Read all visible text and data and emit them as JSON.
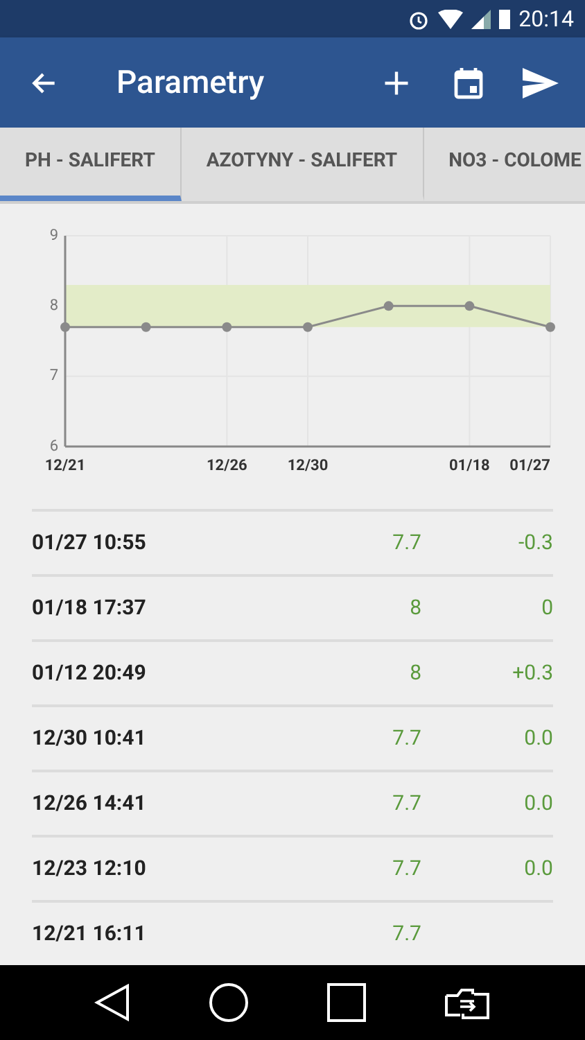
{
  "status_bar": {
    "time": "20:14"
  },
  "app_bar": {
    "title": "Parametry"
  },
  "tabs": [
    {
      "label": "PH - SALIFERT",
      "selected": true
    },
    {
      "label": "AZOTYNY - SALIFERT",
      "selected": false
    },
    {
      "label": "NO3 - COLOME",
      "selected": false
    }
  ],
  "chart_data": {
    "type": "line",
    "series": [
      {
        "color": "#8a8a8a",
        "marker": "circle",
        "values": [
          7.7,
          7.7,
          7.7,
          7.7,
          8,
          8,
          7.7
        ]
      }
    ],
    "grid": true,
    "categories": [
      "12/21",
      null,
      "12/26",
      "12/30",
      null,
      "01/18",
      "01/27"
    ],
    "ylim": [
      6,
      9
    ],
    "yticks": [
      6,
      7,
      8,
      9
    ],
    "bands": [
      {
        "axis": "y",
        "from": 7.7,
        "to": 8.3,
        "color": "#e3ecc8"
      }
    ]
  },
  "rows": [
    {
      "time": "01/27 10:55",
      "value": "7.7",
      "change": "-0.3"
    },
    {
      "time": "01/18 17:37",
      "value": "8",
      "change": "0"
    },
    {
      "time": "01/12 20:49",
      "value": "8",
      "change": "+0.3"
    },
    {
      "time": "12/30 10:41",
      "value": "7.7",
      "change": "0.0"
    },
    {
      "time": "12/26 14:41",
      "value": "7.7",
      "change": "0.0"
    },
    {
      "time": "12/23 12:10",
      "value": "7.7",
      "change": "0.0"
    },
    {
      "time": "12/21 16:11",
      "value": "7.7"
    }
  ]
}
